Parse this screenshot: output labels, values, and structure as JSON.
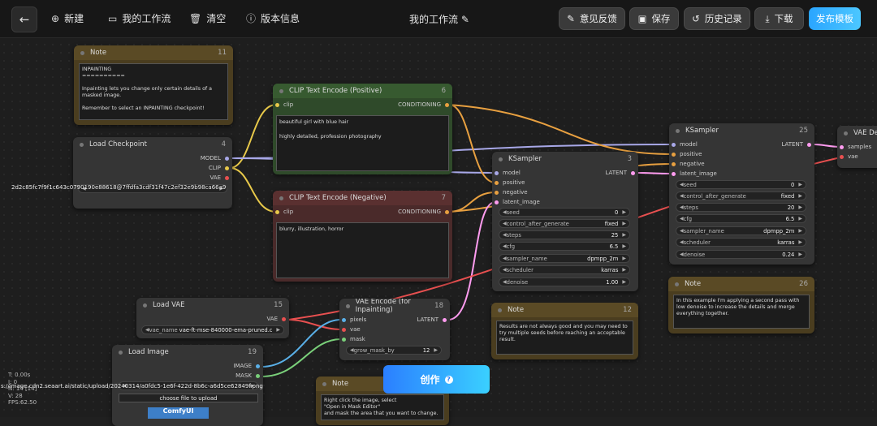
{
  "topbar": {
    "new_label": "新建",
    "workflows_label": "我的工作流",
    "clear_label": "清空",
    "version_label": "版本信息",
    "workflow_title": "我的工作流",
    "feedback_label": "意见反馈",
    "save_label": "保存",
    "history_label": "历史记录",
    "download_label": "下载",
    "publish_label": "发布模板"
  },
  "nodes": {
    "note11": {
      "title": "Note",
      "id": "11",
      "text": "INPAINTING\n==========\n\nInpainting lets you change only certain details of a masked image.\n\nRemember to select an INPAINTING checkpoint!"
    },
    "loadckpt": {
      "title": "Load Checkpoint",
      "id": "4",
      "out_model": "MODEL",
      "out_clip": "CLIP",
      "out_vae": "VAE",
      "overlay": "2d2c85fc7f9f1c643c0790190e88618@7ffdfa3cdf31f47c2ef32e9b98ca66a9"
    },
    "clippos": {
      "title": "CLIP Text Encode (Positive)",
      "id": "6",
      "in_clip": "clip",
      "out": "CONDITIONING",
      "text": "beautiful girl with blue hair\n\nhighly detailed, profession photography"
    },
    "clipneg": {
      "title": "CLIP Text Encode (Negative)",
      "id": "7",
      "in_clip": "clip",
      "out": "CONDITIONING",
      "text": "blurry, illustration, horror"
    },
    "ksampler3": {
      "title": "KSampler",
      "id": "3",
      "inputs": [
        "model",
        "positive",
        "negative",
        "latent_image"
      ],
      "out": "LATENT",
      "widgets": [
        {
          "label": "seed",
          "value": "0"
        },
        {
          "label": "control_after_generate",
          "value": "fixed"
        },
        {
          "label": "steps",
          "value": "25"
        },
        {
          "label": "cfg",
          "value": "6.5"
        },
        {
          "label": "sampler_name",
          "value": "dpmpp_2m"
        },
        {
          "label": "scheduler",
          "value": "karras"
        },
        {
          "label": "denoise",
          "value": "1.00"
        }
      ]
    },
    "ksampler25": {
      "title": "KSampler",
      "id": "25",
      "inputs": [
        "model",
        "positive",
        "negative",
        "latent_image"
      ],
      "out": "LATENT",
      "widgets": [
        {
          "label": "seed",
          "value": "0"
        },
        {
          "label": "control_after_generate",
          "value": "fixed"
        },
        {
          "label": "steps",
          "value": "20"
        },
        {
          "label": "cfg",
          "value": "6.5"
        },
        {
          "label": "sampler_name",
          "value": "dpmpp_2m"
        },
        {
          "label": "scheduler",
          "value": "karras"
        },
        {
          "label": "denoise",
          "value": "0.24"
        }
      ]
    },
    "vaedec": {
      "title": "VAE De",
      "in_samples": "samples",
      "in_vae": "vae"
    },
    "note26": {
      "title": "Note",
      "id": "26",
      "text": "In this example I'm applying a second pass with low denoise to increase the details and merge everything together."
    },
    "note12": {
      "title": "Note",
      "id": "12",
      "text": "Results are not always good and you may need to try multiple seeds before reaching an acceptable result."
    },
    "loadvae": {
      "title": "Load VAE",
      "id": "15",
      "out": "VAE",
      "widget_label": "vae_name",
      "widget_value": "vae-ft-mse-840000-ema-pruned.ckpt"
    },
    "vaeenc": {
      "title": "VAE Encode (for Inpainting)",
      "id": "18",
      "inputs": [
        "pixels",
        "vae",
        "mask"
      ],
      "out": "LATENT",
      "widget_label": "grow_mask_by",
      "widget_value": "12"
    },
    "loadimage": {
      "title": "Load Image",
      "id": "19",
      "out_image": "IMAGE",
      "out_mask": "MASK",
      "overlay": "s://image.cdn2.seaart.ai/static/upload/20240314/a0fdc5-1e6f-422d-8b6c-a6d5ce62849f.png",
      "upload_label": "choose file to upload",
      "thumb_text": "ComfyUI"
    },
    "note_bottom": {
      "title": "Note",
      "text": "Right click the image, select\n\"Open in Mask Editor\"\nand mask the area that you want to change."
    }
  },
  "stats": {
    "t": "T: 0.00s",
    "i": "I: 0",
    "n": "N: 14 [14]",
    "v": "V: 28",
    "fps": "FPS:62.50"
  },
  "create_label": "创作"
}
